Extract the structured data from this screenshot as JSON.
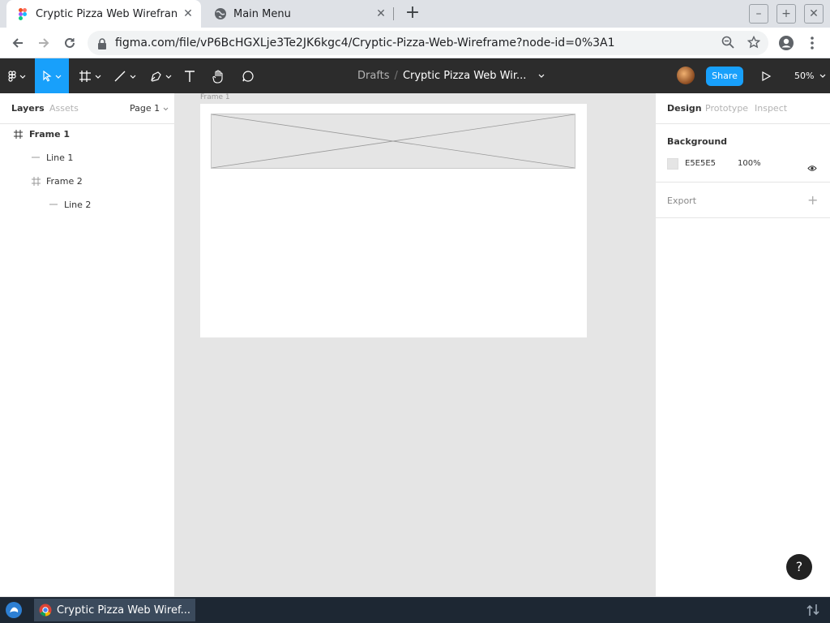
{
  "browser": {
    "tabs": [
      {
        "title": "Cryptic Pizza Web Wirefran",
        "active": true,
        "close": "✕"
      },
      {
        "title": "Main Menu",
        "active": false,
        "close": "✕"
      }
    ],
    "new_tab": "+",
    "url": "figma.com/file/vP6BcHGXLje3Te2JK6kgc4/Cryptic-Pizza-Web-Wireframe?node-id=0%3A1",
    "window_controls": {
      "minimize": "–",
      "maximize": "+",
      "close": "✕"
    }
  },
  "figma": {
    "breadcrumb": {
      "drafts": "Drafts",
      "separator": "/",
      "file": "Cryptic Pizza Web Wir..."
    },
    "share_label": "Share",
    "zoom": "50%",
    "accent_color": "#18a0fb",
    "left_panel": {
      "tabs": {
        "layers": "Layers",
        "assets": "Assets",
        "page": "Page 1"
      },
      "layers": [
        {
          "name": "Frame 1",
          "type": "frame",
          "depth": 0
        },
        {
          "name": "Line 1",
          "type": "line",
          "depth": 1
        },
        {
          "name": "Frame 2",
          "type": "frame",
          "depth": 1
        },
        {
          "name": "Line 2",
          "type": "line",
          "depth": 2
        }
      ]
    },
    "canvas": {
      "frame_label": "Frame 1",
      "background_color": "#e5e5e5"
    },
    "right_panel": {
      "tabs": {
        "design": "Design",
        "prototype": "Prototype",
        "inspect": "Inspect"
      },
      "background_title": "Background",
      "background_hex": "E5E5E5",
      "background_opacity": "100%",
      "export_title": "Export",
      "export_add": "+"
    },
    "help": "?"
  },
  "taskbar": {
    "item_title": "Cryptic Pizza Web Wiref..."
  }
}
